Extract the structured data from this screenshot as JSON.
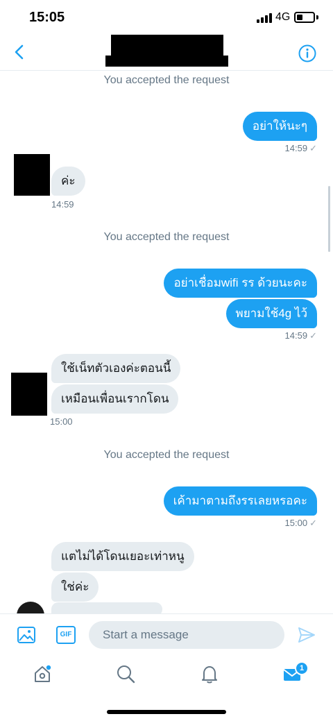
{
  "status_bar": {
    "time": "15:05",
    "network": "4G"
  },
  "header": {
    "back_icon": "chevron-left-icon",
    "info_icon": "info-icon"
  },
  "conversation": {
    "system_notes": [
      "You accepted the request",
      "You accepted the request",
      "You accepted the request"
    ],
    "outgoing": [
      {
        "text": "อย่าให้นะๆ"
      },
      {
        "text": "อย่าเชื่อมwifi รร ด้วยนะคะ"
      },
      {
        "text": "พยามใช้4g ไว้"
      },
      {
        "text": "เค้ามาตามถึงรรเลยหรอคะ"
      }
    ],
    "outgoing_times": [
      "14:59",
      "14:59",
      "15:00"
    ],
    "incoming": [
      {
        "text": "ค่ะ"
      },
      {
        "text": "ใช้เน็ทตัวเองค่ะตอนนี้"
      },
      {
        "text": "เหมือนเพื่อนเรากโดน"
      },
      {
        "text": "แตไม่ได้โดนเยอะเท่าหนู"
      },
      {
        "text": "ใช่ค่ะ"
      }
    ],
    "incoming_times": [
      "14:59",
      "15:00"
    ],
    "read_check": "✓"
  },
  "composer": {
    "placeholder": "Start a message",
    "gif_label": "GIF"
  },
  "tabbar": {
    "messages_badge": "1"
  },
  "colors": {
    "accent": "#1da1f2",
    "incoming_bubble": "#e6ecf0",
    "muted_text": "#657786"
  }
}
